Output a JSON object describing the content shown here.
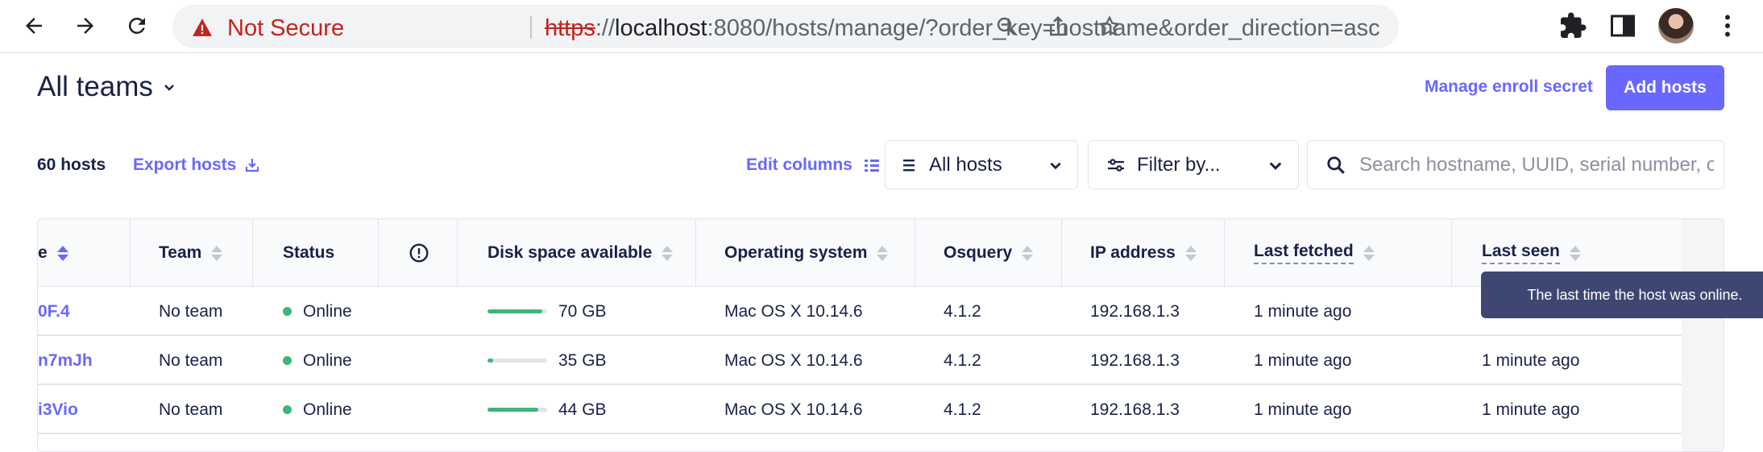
{
  "browser": {
    "not_secure": "Not Secure",
    "url_scheme": "https",
    "url_sep": "://",
    "url_host": "localhost",
    "url_rest": ":8080/hosts/manage/?order_key=hostname&order_direction=asc"
  },
  "header": {
    "team_title": "All teams",
    "manage_enroll": "Manage enroll secret",
    "add_hosts": "Add hosts"
  },
  "toolbar": {
    "host_count": "60 hosts",
    "export": "Export hosts",
    "edit_columns": "Edit columns",
    "status_filter": "All hosts",
    "filter_by": "Filter by...",
    "search_placeholder": "Search hostname, UUID, serial number, or IP address"
  },
  "table": {
    "headers": {
      "hostname": "e",
      "team": "Team",
      "status": "Status",
      "disk": "Disk space available",
      "os": "Operating system",
      "osquery": "Osquery",
      "ip": "IP address",
      "last_fetched": "Last fetched",
      "last_seen": "Last seen"
    },
    "rows": [
      {
        "hostname": "0F.4",
        "team": "No team",
        "status": "Online",
        "disk_fraction": 0.92,
        "disk": "70 GB",
        "os": "Mac OS X 10.14.6",
        "osquery": "4.1.2",
        "ip": "192.168.1.3",
        "last_fetched": "1 minute ago",
        "last_seen": ""
      },
      {
        "hostname": "n7mJh",
        "team": "No team",
        "status": "Online",
        "disk_fraction": 0.1,
        "disk": "35 GB",
        "os": "Mac OS X 10.14.6",
        "osquery": "4.1.2",
        "ip": "192.168.1.3",
        "last_fetched": "1 minute ago",
        "last_seen": "1 minute ago"
      },
      {
        "hostname": "i3Vio",
        "team": "No team",
        "status": "Online",
        "disk_fraction": 0.85,
        "disk": "44 GB",
        "os": "Mac OS X 10.14.6",
        "osquery": "4.1.2",
        "ip": "192.168.1.3",
        "last_fetched": "1 minute ago",
        "last_seen": "1 minute ago"
      }
    ]
  },
  "tooltip": "The last time the host was online.",
  "colors": {
    "accent": "#6a67fe",
    "online": "#3db67b",
    "tooltip_bg": "#3e4771",
    "warning": "#c5221f"
  }
}
